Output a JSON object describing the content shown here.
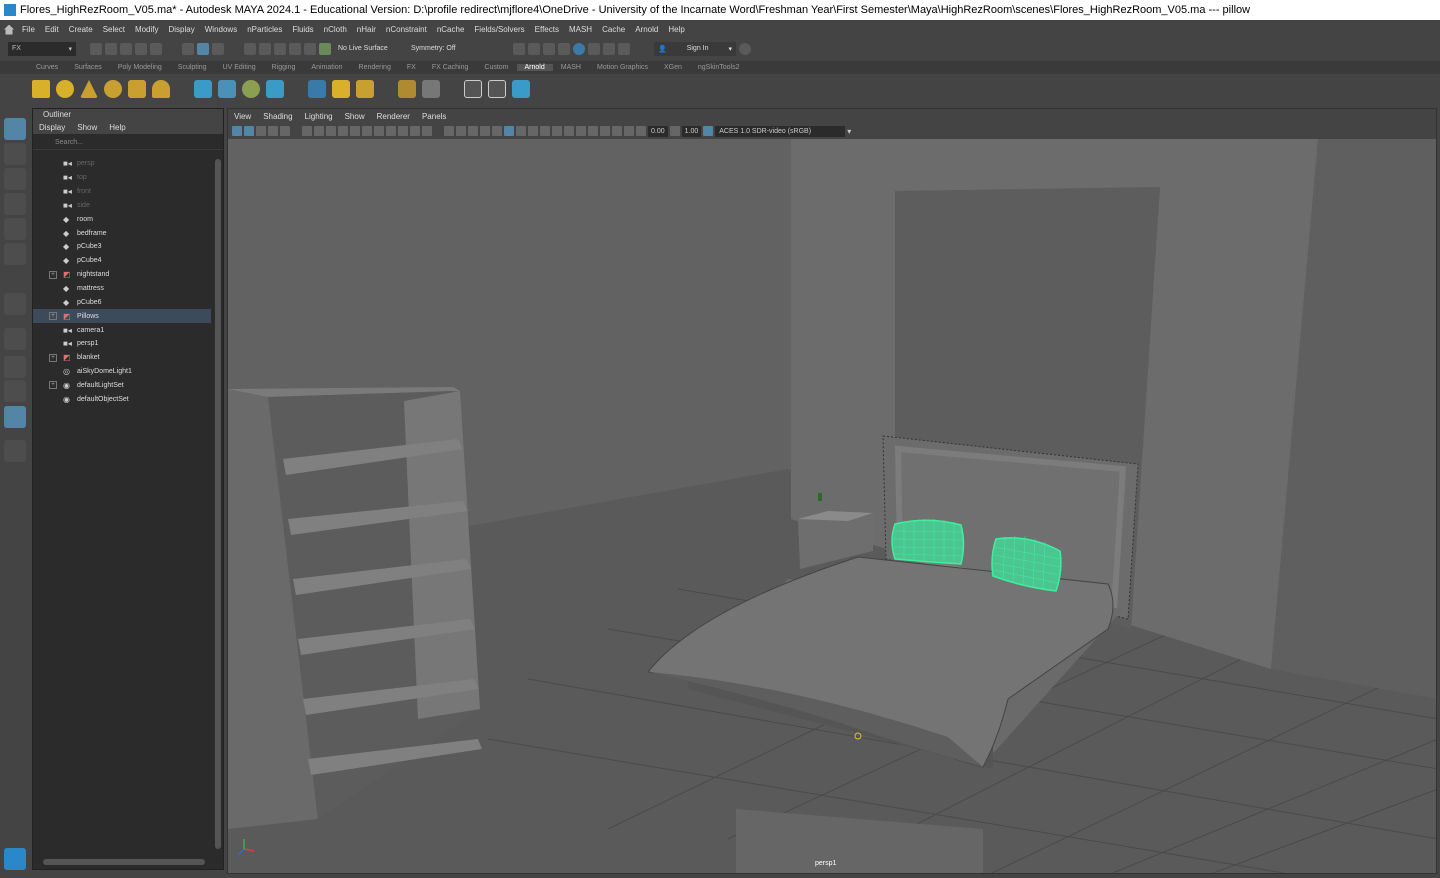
{
  "window": {
    "title": "Flores_HighRezRoom_V05.ma* - Autodesk MAYA 2024.1 - Educational Version: D:\\profile redirect\\mjflore4\\OneDrive - University of the Incarnate Word\\Freshman Year\\First Semester\\Maya\\HighRezRoom\\scenes\\Flores_HighRezRoom_V05.ma   ---   pillow"
  },
  "menubar": {
    "items": [
      "File",
      "Edit",
      "Create",
      "Select",
      "Modify",
      "Display",
      "Windows",
      "nParticles",
      "Fluids",
      "nCloth",
      "nHair",
      "nConstraint",
      "nCache",
      "Fields/Solvers",
      "Effects",
      "MASH",
      "Cache",
      "Arnold",
      "Help"
    ]
  },
  "statusline": {
    "menuset": "FX",
    "live_surface": "No Live Surface",
    "symmetry": "Symmetry: Off",
    "sign_in": "Sign In"
  },
  "shelf": {
    "tabs": [
      "Curves",
      "Surfaces",
      "Poly Modeling",
      "Sculpting",
      "UV Editing",
      "Rigging",
      "Animation",
      "Rendering",
      "FX",
      "FX Caching",
      "Custom",
      "Arnold",
      "MASH",
      "Motion Graphics",
      "XGen",
      "ngSkinTools2"
    ],
    "active_tab": "Arnold"
  },
  "outliner": {
    "title": "Outliner",
    "menu": [
      "Display",
      "Show",
      "Help"
    ],
    "search_placeholder": "Search...",
    "items": [
      {
        "label": "persp",
        "icon": "camera-icon",
        "dim": true,
        "expandable": false
      },
      {
        "label": "top",
        "icon": "camera-icon",
        "dim": true,
        "expandable": false
      },
      {
        "label": "front",
        "icon": "camera-icon",
        "dim": true,
        "expandable": false
      },
      {
        "label": "side",
        "icon": "camera-icon",
        "dim": true,
        "expandable": false
      },
      {
        "label": "room",
        "icon": "mesh-icon",
        "dim": false,
        "expandable": false
      },
      {
        "label": "bedframe",
        "icon": "mesh-icon",
        "dim": false,
        "expandable": false
      },
      {
        "label": "pCube3",
        "icon": "mesh-icon",
        "dim": false,
        "expandable": false
      },
      {
        "label": "pCube4",
        "icon": "mesh-icon",
        "dim": false,
        "expandable": false
      },
      {
        "label": "nightstand",
        "icon": "group-icon",
        "dim": false,
        "expandable": true
      },
      {
        "label": "mattress",
        "icon": "mesh-icon",
        "dim": false,
        "expandable": false
      },
      {
        "label": "pCube6",
        "icon": "mesh-icon",
        "dim": false,
        "expandable": false
      },
      {
        "label": "Pillows",
        "icon": "group-icon",
        "dim": false,
        "expandable": true,
        "selected": true
      },
      {
        "label": "camera1",
        "icon": "camera-icon",
        "dim": false,
        "expandable": false
      },
      {
        "label": "persp1",
        "icon": "camera-icon",
        "dim": false,
        "expandable": false
      },
      {
        "label": "blanket",
        "icon": "group-icon",
        "dim": false,
        "expandable": true
      },
      {
        "label": "aiSkyDomeLight1",
        "icon": "skydome-icon",
        "dim": false,
        "expandable": false
      },
      {
        "label": "defaultLightSet",
        "icon": "set-icon",
        "dim": false,
        "expandable": true
      },
      {
        "label": "defaultObjectSet",
        "icon": "set-icon",
        "dim": false,
        "expandable": false
      }
    ]
  },
  "viewport": {
    "menu": [
      "View",
      "Shading",
      "Lighting",
      "Show",
      "Renderer",
      "Panels"
    ],
    "exposure": "0.00",
    "gamma": "1.00",
    "color_space": "ACES 1.0 SDR-video (sRGB)",
    "camera": "persp1",
    "selection_color": "#3cf0a0"
  }
}
